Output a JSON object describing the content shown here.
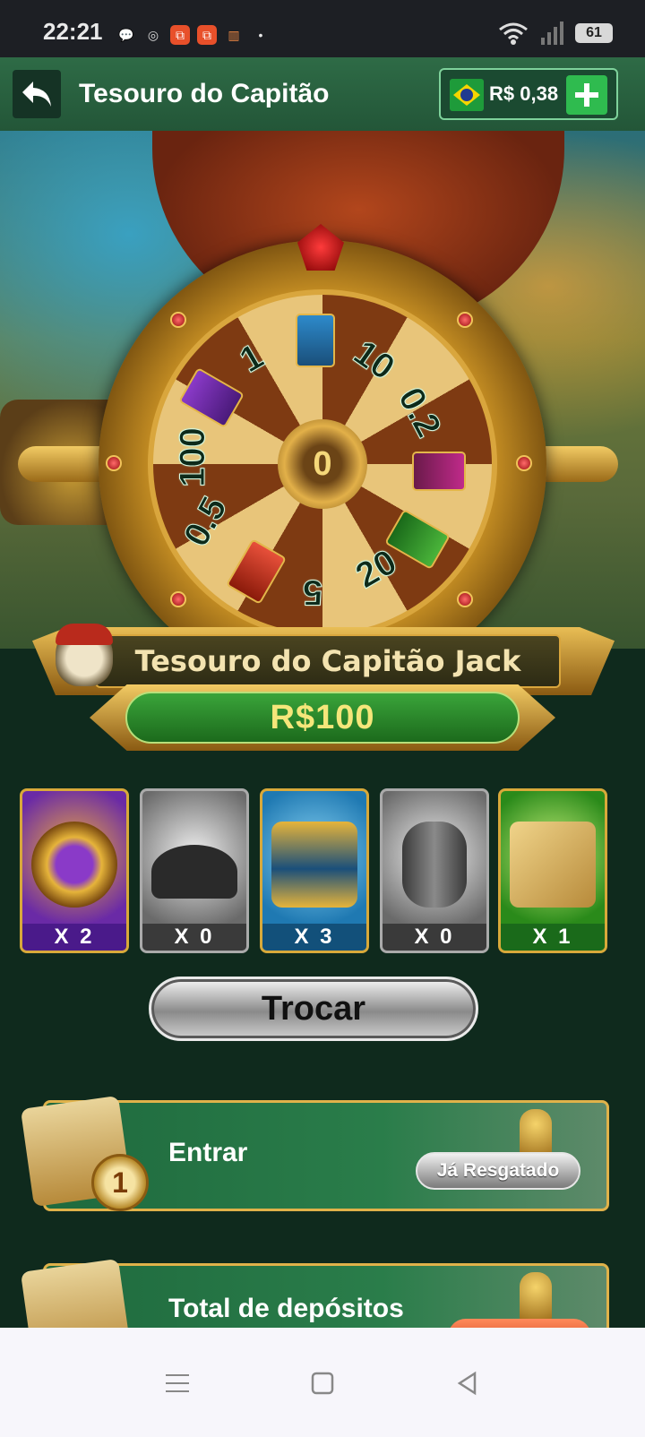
{
  "status_bar": {
    "time": "22:21",
    "battery": "61"
  },
  "header": {
    "title": "Tesouro do Capitão",
    "balance": "R$ 0,38",
    "country_flag": "brazil-flag-icon"
  },
  "wheel": {
    "center_value": "0",
    "segments": [
      "1",
      "10",
      "0.2",
      "20",
      "5",
      "0.5",
      "100"
    ]
  },
  "event": {
    "banner_title": "Tesouro do Capitão Jack",
    "prize": "R$100"
  },
  "cards": [
    {
      "icon": "compass-icon",
      "count": "X 2",
      "color": "#6a2aa6"
    },
    {
      "icon": "pirate-hat-icon",
      "count": "X 0",
      "color": "#8a8a8a"
    },
    {
      "icon": "treasure-chest-icon",
      "count": "X 3",
      "color": "#1f79b2"
    },
    {
      "icon": "barrel-bomb-icon",
      "count": "X 0",
      "color": "#8a8a8a"
    },
    {
      "icon": "treasure-map-icon",
      "count": "X 1",
      "color": "#3a9a2a"
    }
  ],
  "actions": {
    "exchange_label": "Trocar"
  },
  "tasks": [
    {
      "label": "Entrar",
      "medal": "1",
      "status": "Já Resgatado"
    },
    {
      "label": "Total de depósitos"
    }
  ],
  "colors": {
    "header": "#2e6b46",
    "background": "#0f2a1d",
    "accent_gold": "#d9a63d"
  }
}
